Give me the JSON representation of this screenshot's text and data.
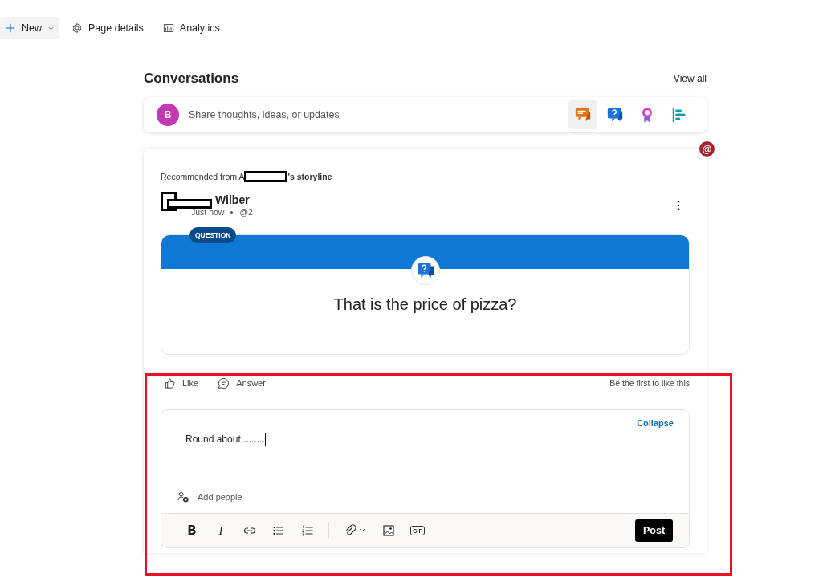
{
  "command_bar": {
    "items": [
      {
        "kind": "new",
        "label": "New"
      },
      {
        "kind": "details",
        "label": "Page details"
      },
      {
        "kind": "analytics",
        "label": "Analytics"
      }
    ]
  },
  "conversations": {
    "title": "Conversations",
    "view_all": "View all",
    "composer": {
      "avatar_letter": "B",
      "placeholder": "Share thoughts, ideas, or updates",
      "post_types": [
        {
          "kind": "discussion",
          "selected": true
        },
        {
          "kind": "question",
          "selected": false
        },
        {
          "kind": "praise",
          "selected": false
        },
        {
          "kind": "poll",
          "selected": false
        }
      ]
    },
    "mention_badge": "@",
    "post": {
      "recommended_prefix": "Recommended from A",
      "recommended_suffix": "'s storyline",
      "author": "Wilber",
      "time": "Just now",
      "mention": "@2",
      "question": {
        "badge": "QUESTION",
        "text": "That is the price of pizza?"
      },
      "actions": [
        {
          "kind": "like",
          "label": "Like"
        },
        {
          "kind": "answer",
          "label": "Answer"
        }
      ],
      "likes_note": "Be the first to like this",
      "reply": {
        "collapse": "Collapse",
        "value": "Round about.........",
        "add_people": "Add people",
        "tools": [
          {
            "kind": "bold",
            "label": "B"
          },
          {
            "kind": "italic",
            "label": "I"
          },
          {
            "kind": "link"
          },
          {
            "kind": "bullets"
          },
          {
            "kind": "numbers"
          },
          {
            "kind": "attach"
          },
          {
            "kind": "image"
          },
          {
            "kind": "gif",
            "label": "GIF"
          }
        ],
        "post_button": "Post"
      }
    }
  }
}
